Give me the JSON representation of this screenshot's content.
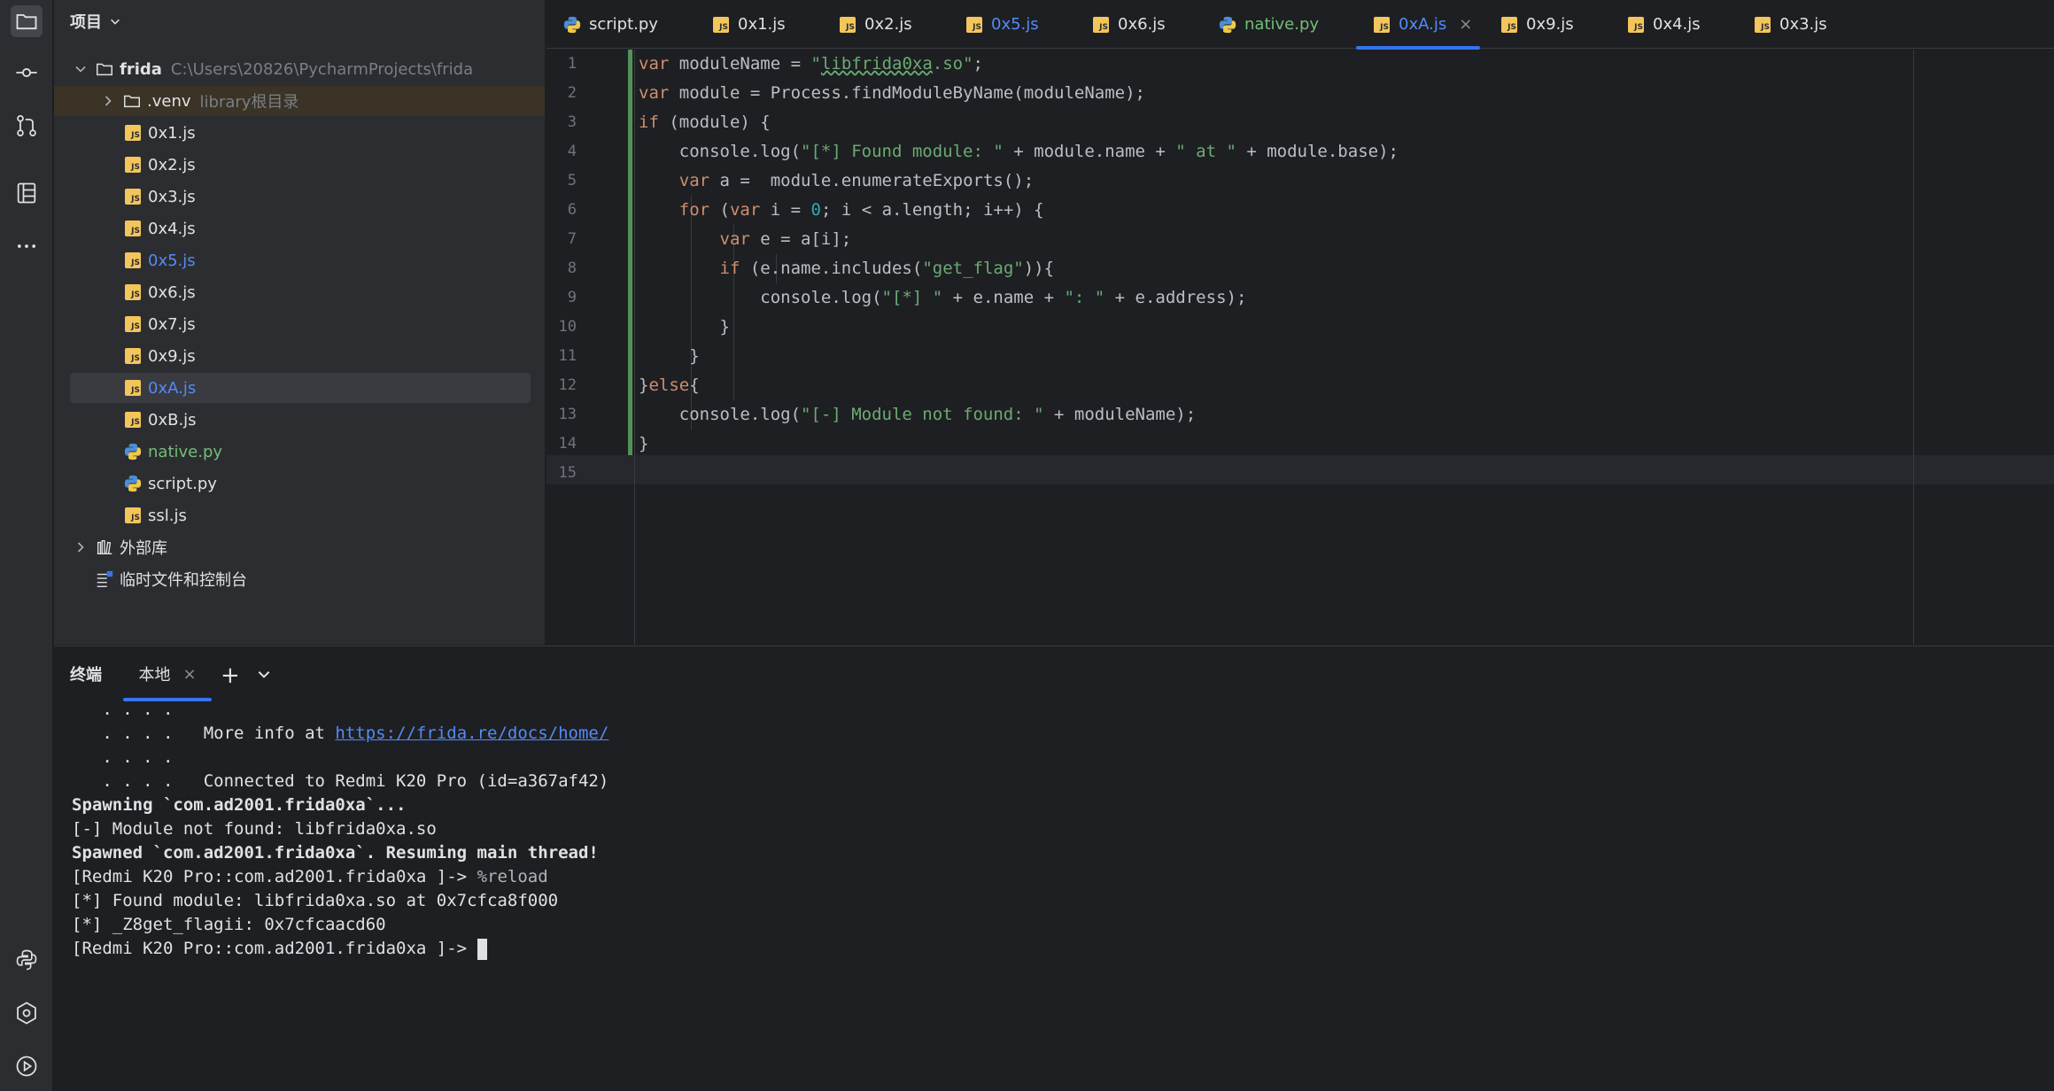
{
  "toolbar": {
    "items": [
      "folder-icon",
      "commit-icon",
      "pull-request-icon",
      "structure-icon",
      "more-icon",
      "python-console-icon",
      "services-icon",
      "run-icon"
    ]
  },
  "project": {
    "title": "项目",
    "root": {
      "name": "frida",
      "path": "C:\\Users\\20826\\PycharmProjects\\frida"
    },
    "venv": {
      "name": ".venv",
      "hint": "library根目录"
    },
    "files": [
      {
        "name": "0x1.js",
        "color": "normal"
      },
      {
        "name": "0x2.js",
        "color": "normal"
      },
      {
        "name": "0x3.js",
        "color": "normal"
      },
      {
        "name": "0x4.js",
        "color": "normal"
      },
      {
        "name": "0x5.js",
        "color": "blue"
      },
      {
        "name": "0x6.js",
        "color": "normal"
      },
      {
        "name": "0x7.js",
        "color": "normal"
      },
      {
        "name": "0x9.js",
        "color": "normal"
      },
      {
        "name": "0xA.js",
        "color": "blue"
      },
      {
        "name": "0xB.js",
        "color": "normal"
      },
      {
        "name": "native.py",
        "color": "green"
      },
      {
        "name": "script.py",
        "color": "normal"
      },
      {
        "name": "ssl.js",
        "color": "normal"
      }
    ],
    "external_libs": "外部库",
    "scratches": "临时文件和控制台"
  },
  "tabs": [
    {
      "label": "script.py",
      "type": "py",
      "color": "normal"
    },
    {
      "label": "0x1.js",
      "type": "js",
      "color": "normal"
    },
    {
      "label": "0x2.js",
      "type": "js",
      "color": "normal"
    },
    {
      "label": "0x5.js",
      "type": "js",
      "color": "blue"
    },
    {
      "label": "0x6.js",
      "type": "js",
      "color": "normal"
    },
    {
      "label": "native.py",
      "type": "py",
      "color": "green"
    },
    {
      "label": "0xA.js",
      "type": "js",
      "color": "blue",
      "active": true,
      "close": "×"
    },
    {
      "label": "0x9.js",
      "type": "js",
      "color": "normal"
    },
    {
      "label": "0x4.js",
      "type": "js",
      "color": "normal"
    },
    {
      "label": "0x3.js",
      "type": "js",
      "color": "normal"
    }
  ],
  "editor": {
    "line_numbers": [
      "1",
      "2",
      "3",
      "4",
      "5",
      "6",
      "7",
      "8",
      "9",
      "10",
      "11",
      "12",
      "13",
      "14",
      "15"
    ],
    "lines": [
      [
        {
          "t": "var",
          "c": "kw"
        },
        {
          "t": " moduleName = "
        },
        {
          "t": "\"",
          "c": "str"
        },
        {
          "t": "libfrida0xa",
          "c": "str wavy"
        },
        {
          "t": ".so\"",
          "c": "str"
        },
        {
          "t": ";"
        }
      ],
      [
        {
          "t": "var",
          "c": "kw"
        },
        {
          "t": " module = Process.findModuleByName(moduleName);"
        }
      ],
      [
        {
          "t": "if",
          "c": "kw"
        },
        {
          "t": " (module) {"
        }
      ],
      [
        {
          "t": "    console.log("
        },
        {
          "t": "\"[*] Found module: \"",
          "c": "str"
        },
        {
          "t": " + module.name + "
        },
        {
          "t": "\" at \"",
          "c": "str"
        },
        {
          "t": " + module.base);"
        }
      ],
      [
        {
          "t": "    "
        },
        {
          "t": "var",
          "c": "kw"
        },
        {
          "t": " a =  module.enumerateExports();"
        }
      ],
      [
        {
          "t": "    "
        },
        {
          "t": "for",
          "c": "kw"
        },
        {
          "t": " ("
        },
        {
          "t": "var",
          "c": "kw"
        },
        {
          "t": " i = "
        },
        {
          "t": "0",
          "c": "num"
        },
        {
          "t": "; i < a.length; i++) {"
        }
      ],
      [
        {
          "t": "        "
        },
        {
          "t": "var",
          "c": "kw"
        },
        {
          "t": " e = a[i];"
        }
      ],
      [
        {
          "t": "        "
        },
        {
          "t": "if",
          "c": "kw"
        },
        {
          "t": " (e.name.includes("
        },
        {
          "t": "\"get_flag\"",
          "c": "str"
        },
        {
          "t": ")){"
        }
      ],
      [
        {
          "t": "            console.log("
        },
        {
          "t": "\"[*] \"",
          "c": "str"
        },
        {
          "t": " + e.name + "
        },
        {
          "t": "\": \"",
          "c": "str"
        },
        {
          "t": " + e.address);"
        }
      ],
      [
        {
          "t": "        }"
        }
      ],
      [
        {
          "t": "     }"
        }
      ],
      [
        {
          "t": "}"
        },
        {
          "t": "else",
          "c": "kw"
        },
        {
          "t": "{"
        }
      ],
      [
        {
          "t": "    console.log("
        },
        {
          "t": "\"[-] Module not found: \"",
          "c": "str"
        },
        {
          "t": " + moduleName);"
        }
      ],
      [
        {
          "t": "}"
        }
      ],
      [
        {
          "t": ""
        }
      ]
    ]
  },
  "terminal": {
    "title": "终端",
    "tab": "本地",
    "tab_close": "×",
    "add": "+",
    "lines": [
      [
        {
          "t": "   . . . ."
        }
      ],
      [
        {
          "t": "   . . . .   More info at "
        },
        {
          "t": "https://frida.re/docs/home/",
          "c": "link"
        }
      ],
      [
        {
          "t": "   . . . ."
        }
      ],
      [
        {
          "t": "   . . . .   Connected to Redmi K20 Pro (id=a367af42)"
        }
      ],
      [
        {
          "t": "Spawning `com.ad2001.frida0xa`...",
          "c": "bold"
        }
      ],
      [
        {
          "t": "[-] Module not found: libfrida0xa.so"
        }
      ],
      [
        {
          "t": "Spawned `com.ad2001.frida0xa`. Resuming main thread!",
          "c": "bold"
        }
      ],
      [
        {
          "t": "[Redmi K20 Pro::com.ad2001.frida0xa ]-> "
        },
        {
          "t": "%reload",
          "c": "dim"
        }
      ],
      [
        {
          "t": "[*] Found module: libfrida0xa.so at 0x7cfca8f000"
        }
      ],
      [
        {
          "t": "[*] _Z8get_flagii: 0x7cfcaacd60"
        }
      ],
      [
        {
          "t": "[Redmi K20 Pro::com.ad2001.frida0xa ]-> "
        },
        {
          "t": "",
          "c": "cursor"
        }
      ]
    ]
  }
}
